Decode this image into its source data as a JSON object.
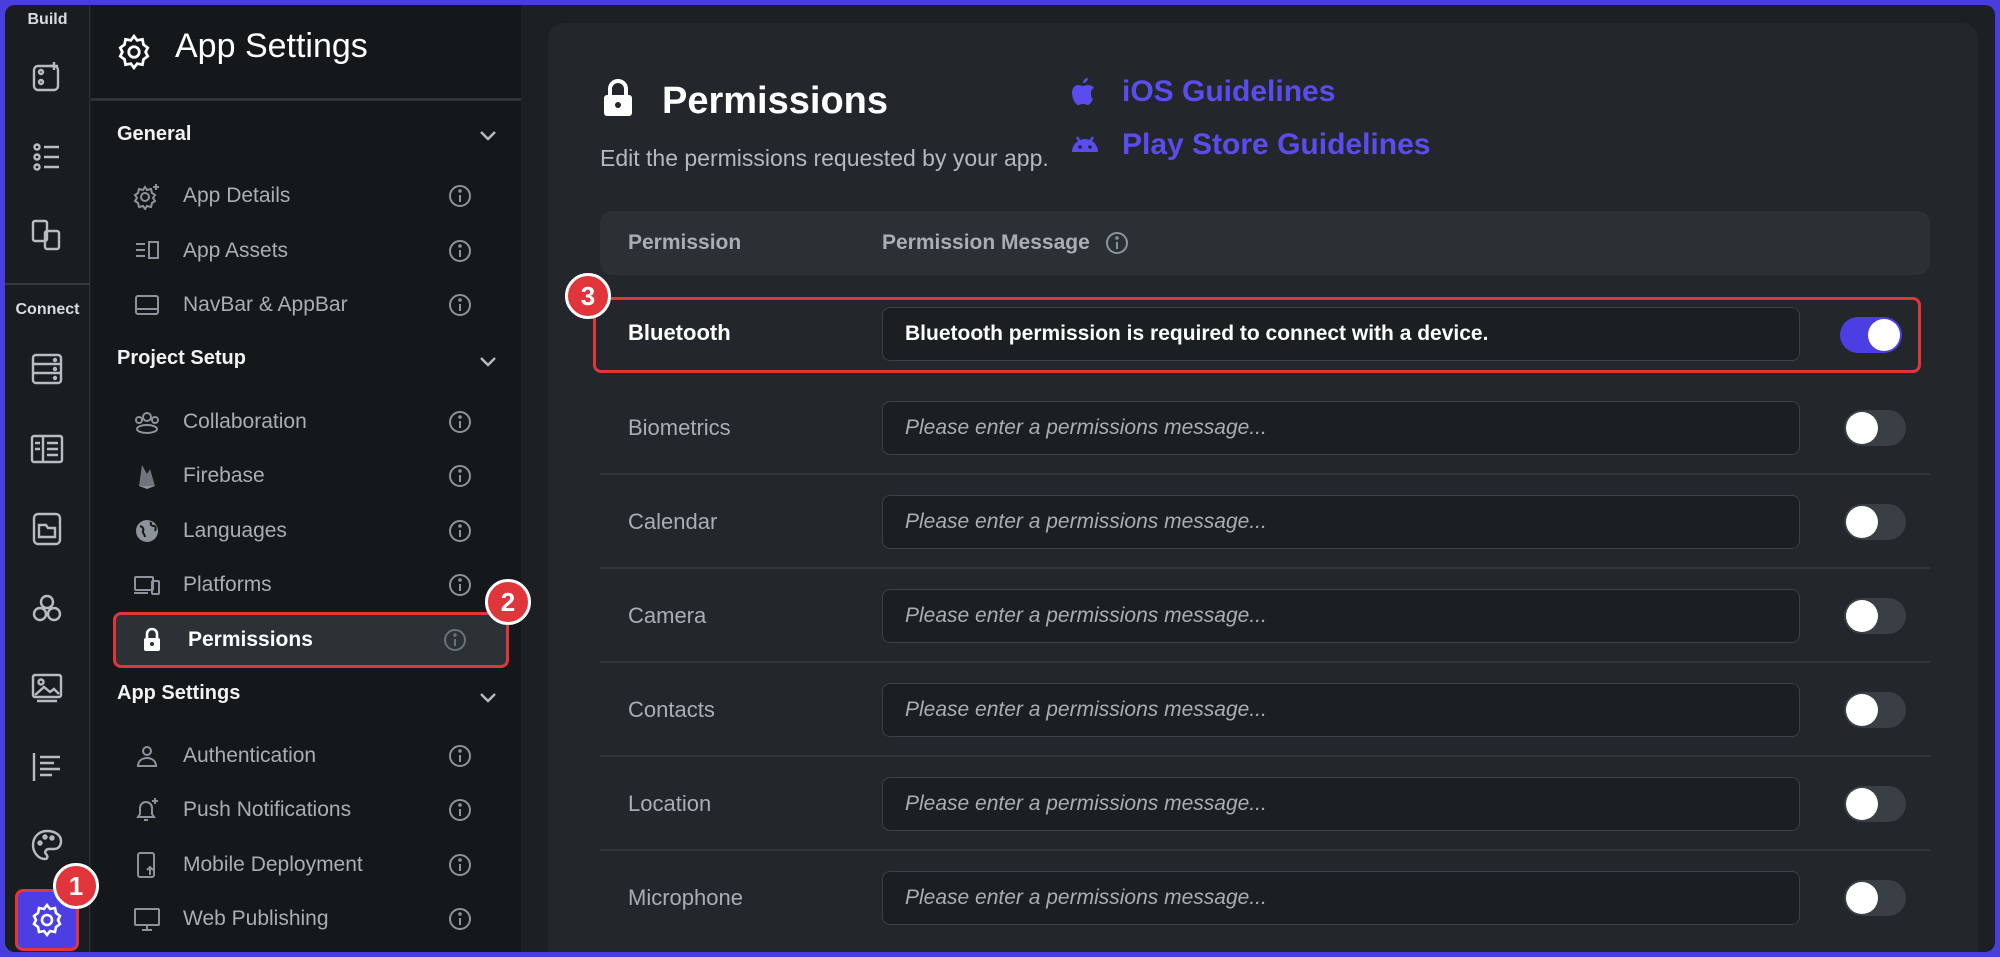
{
  "rail": {
    "build_label": "Build",
    "connect_label": "Connect",
    "icons": [
      "add-page-icon",
      "list-icon",
      "components-icon",
      "database-icon",
      "storyboard-icon",
      "media-icon",
      "integrations-icon",
      "gallery-icon",
      "text-icon",
      "theme-icon",
      "settings-icon"
    ]
  },
  "sidebar": {
    "title": "App Settings",
    "groups": [
      {
        "label": "General",
        "items": [
          {
            "label": "App Details"
          },
          {
            "label": "App Assets"
          },
          {
            "label": "NavBar & AppBar"
          }
        ]
      },
      {
        "label": "Project Setup",
        "items": [
          {
            "label": "Collaboration"
          },
          {
            "label": "Firebase"
          },
          {
            "label": "Languages"
          },
          {
            "label": "Platforms"
          },
          {
            "label": "Permissions"
          }
        ]
      },
      {
        "label": "App Settings",
        "items": [
          {
            "label": "Authentication"
          },
          {
            "label": "Push Notifications"
          },
          {
            "label": "Mobile Deployment"
          },
          {
            "label": "Web Publishing"
          }
        ]
      }
    ]
  },
  "badges": {
    "one": "1",
    "two": "2",
    "three": "3"
  },
  "main": {
    "title": "Permissions",
    "subtitle": "Edit the permissions requested by your app.",
    "ios_link": "iOS Guidelines",
    "play_link": "Play Store Guidelines",
    "col_permission": "Permission",
    "col_message": "Permission Message",
    "placeholder": "Please enter a permissions message...",
    "rows": [
      {
        "name": "Bluetooth",
        "message": "Bluetooth permission is required to connect with a device.",
        "enabled": true
      },
      {
        "name": "Biometrics",
        "message": "",
        "enabled": false
      },
      {
        "name": "Calendar",
        "message": "",
        "enabled": false
      },
      {
        "name": "Camera",
        "message": "",
        "enabled": false
      },
      {
        "name": "Contacts",
        "message": "",
        "enabled": false
      },
      {
        "name": "Location",
        "message": "",
        "enabled": false
      },
      {
        "name": "Microphone",
        "message": "",
        "enabled": false
      }
    ]
  },
  "colors": {
    "accent": "#4b3fe4",
    "link": "#5b4cf0",
    "highlight": "#e0353b"
  }
}
